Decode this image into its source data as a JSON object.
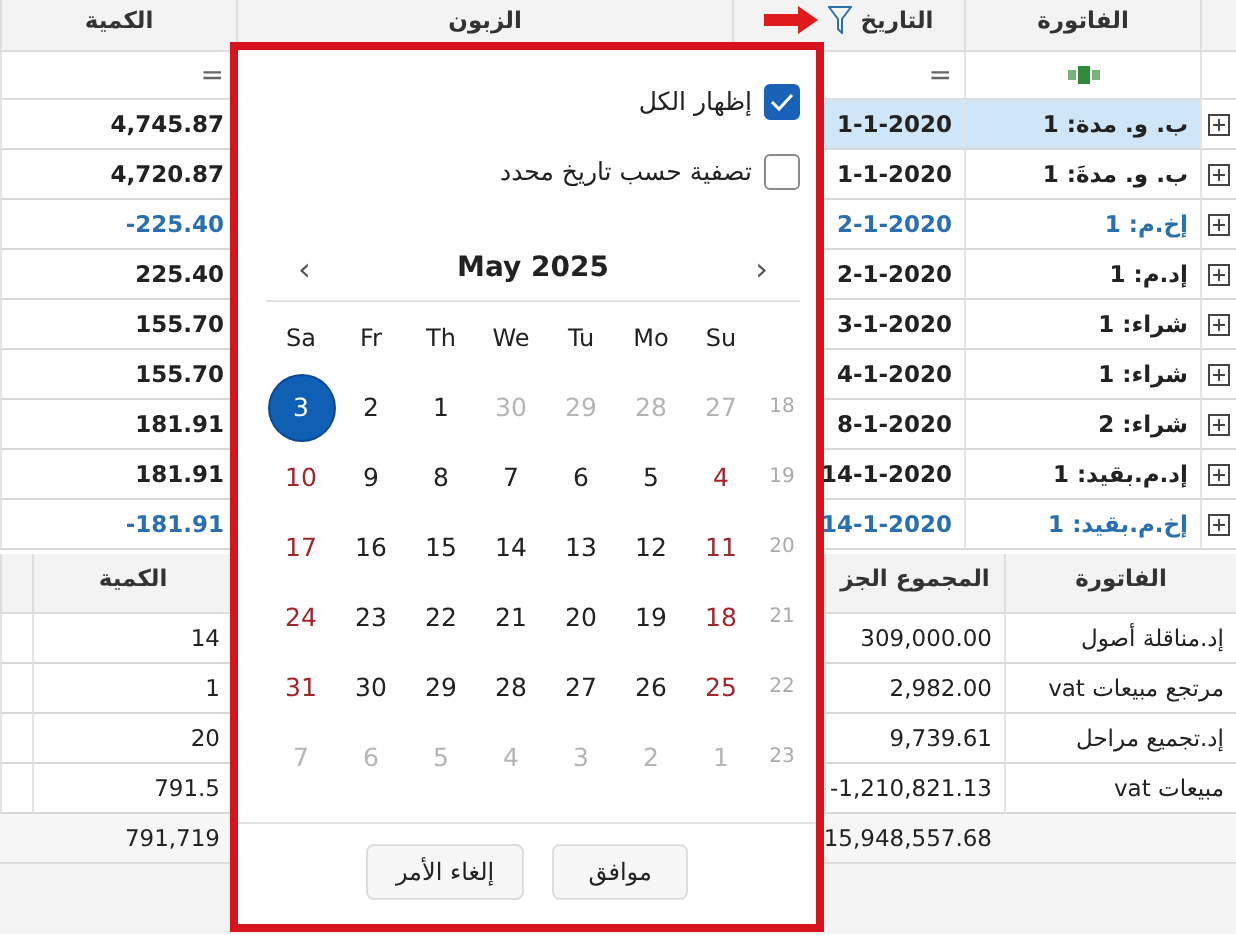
{
  "top_grid": {
    "columns": [
      "الفاتورة",
      "التاريخ",
      "الزبون",
      "الكمية"
    ],
    "filter_row": {
      "date": "=",
      "quantity": "="
    },
    "rows": [
      {
        "invoice": "ب. و. مدة: 1",
        "date": "1-1-2020",
        "quantity": "4,745.87",
        "kind": "normal",
        "selected": true
      },
      {
        "invoice": "ب. و. مدةَ: 1",
        "date": "1-1-2020",
        "quantity": "4,720.87",
        "kind": "normal",
        "selected": false
      },
      {
        "invoice": "إخ.م: 1",
        "date": "2-1-2020",
        "quantity": "-225.40",
        "kind": "return",
        "selected": false
      },
      {
        "invoice": "إد.م: 1",
        "date": "2-1-2020",
        "quantity": "225.40",
        "kind": "normal",
        "selected": false
      },
      {
        "invoice": "شراء: 1",
        "date": "3-1-2020",
        "quantity": "155.70",
        "kind": "normal",
        "selected": false
      },
      {
        "invoice": "شراء: 1",
        "date": "4-1-2020",
        "quantity": "155.70",
        "kind": "normal",
        "selected": false
      },
      {
        "invoice": "شراء: 2",
        "date": "8-1-2020",
        "quantity": "181.91",
        "kind": "normal",
        "selected": false
      },
      {
        "invoice": "إد.م.بقيد: 1",
        "date": "14-1-2020",
        "quantity": "181.91",
        "kind": "normal",
        "selected": false
      },
      {
        "invoice": "إخ.م.بقيد: 1",
        "date": "14-1-2020",
        "quantity": "-181.91",
        "kind": "return",
        "selected": false
      }
    ]
  },
  "bottom_grid": {
    "columns": [
      "الفاتورة",
      "المجموع الجز",
      "الكمية"
    ],
    "rows": [
      {
        "invoice": "إد.مناقلة أصول",
        "subtotal": "309,000.00",
        "quantity": "14"
      },
      {
        "invoice": "مرتجع مبيعات vat",
        "subtotal": "2,982.00",
        "quantity": "1"
      },
      {
        "invoice": "إد.تجميع مراحل",
        "subtotal": "9,739.61",
        "quantity": "20"
      },
      {
        "invoice": "مبيعات vat",
        "subtotal": "-1,210,821.13",
        "quantity": "791.5"
      }
    ],
    "totals": {
      "subtotal": "15,948,557.68",
      "quantity": "791,719"
    }
  },
  "date_filter": {
    "options": [
      {
        "label": "إظهار الكل",
        "checked": true
      },
      {
        "label": "تصفية حسب تاريخ محدد",
        "checked": false
      }
    ],
    "calendar": {
      "prev": "‹",
      "title": "May 2025",
      "next": "›",
      "weekdays": [
        "Su",
        "Mo",
        "Tu",
        "We",
        "Th",
        "Fr",
        "Sa"
      ],
      "weeks": [
        {
          "week": "18",
          "days": [
            {
              "label": "27",
              "kind": "muted",
              "selected": false
            },
            {
              "label": "28",
              "kind": "muted",
              "selected": false
            },
            {
              "label": "29",
              "kind": "muted",
              "selected": false
            },
            {
              "label": "30",
              "kind": "muted",
              "selected": false
            },
            {
              "label": "1",
              "kind": "normal",
              "selected": false
            },
            {
              "label": "2",
              "kind": "normal",
              "selected": false
            },
            {
              "label": "3",
              "kind": "weekend",
              "selected": true
            }
          ]
        },
        {
          "week": "19",
          "days": [
            {
              "label": "4",
              "kind": "weekend",
              "selected": false
            },
            {
              "label": "5",
              "kind": "normal",
              "selected": false
            },
            {
              "label": "6",
              "kind": "normal",
              "selected": false
            },
            {
              "label": "7",
              "kind": "normal",
              "selected": false
            },
            {
              "label": "8",
              "kind": "normal",
              "selected": false
            },
            {
              "label": "9",
              "kind": "normal",
              "selected": false
            },
            {
              "label": "10",
              "kind": "weekend",
              "selected": false
            }
          ]
        },
        {
          "week": "20",
          "days": [
            {
              "label": "11",
              "kind": "weekend",
              "selected": false
            },
            {
              "label": "12",
              "kind": "normal",
              "selected": false
            },
            {
              "label": "13",
              "kind": "normal",
              "selected": false
            },
            {
              "label": "14",
              "kind": "normal",
              "selected": false
            },
            {
              "label": "15",
              "kind": "normal",
              "selected": false
            },
            {
              "label": "16",
              "kind": "normal",
              "selected": false
            },
            {
              "label": "17",
              "kind": "weekend",
              "selected": false
            }
          ]
        },
        {
          "week": "21",
          "days": [
            {
              "label": "18",
              "kind": "weekend",
              "selected": false
            },
            {
              "label": "19",
              "kind": "normal",
              "selected": false
            },
            {
              "label": "20",
              "kind": "normal",
              "selected": false
            },
            {
              "label": "21",
              "kind": "normal",
              "selected": false
            },
            {
              "label": "22",
              "kind": "normal",
              "selected": false
            },
            {
              "label": "23",
              "kind": "normal",
              "selected": false
            },
            {
              "label": "24",
              "kind": "weekend",
              "selected": false
            }
          ]
        },
        {
          "week": "22",
          "days": [
            {
              "label": "25",
              "kind": "weekend",
              "selected": false
            },
            {
              "label": "26",
              "kind": "normal",
              "selected": false
            },
            {
              "label": "27",
              "kind": "normal",
              "selected": false
            },
            {
              "label": "28",
              "kind": "normal",
              "selected": false
            },
            {
              "label": "29",
              "kind": "normal",
              "selected": false
            },
            {
              "label": "30",
              "kind": "normal",
              "selected": false
            },
            {
              "label": "31",
              "kind": "weekend",
              "selected": false
            }
          ]
        },
        {
          "week": "23",
          "days": [
            {
              "label": "1",
              "kind": "muted",
              "selected": false
            },
            {
              "label": "2",
              "kind": "muted",
              "selected": false
            },
            {
              "label": "3",
              "kind": "muted",
              "selected": false
            },
            {
              "label": "4",
              "kind": "muted",
              "selected": false
            },
            {
              "label": "5",
              "kind": "muted",
              "selected": false
            },
            {
              "label": "6",
              "kind": "muted",
              "selected": false
            },
            {
              "label": "7",
              "kind": "muted",
              "selected": false
            }
          ]
        }
      ]
    },
    "buttons": [
      "موافق",
      "إلغاء الأمر"
    ]
  }
}
